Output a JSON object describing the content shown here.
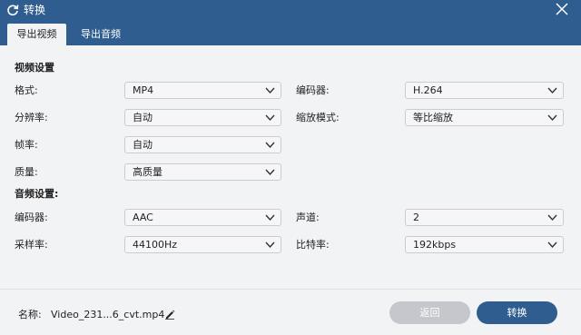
{
  "window": {
    "title": "转换",
    "title_icon": "refresh-icon",
    "close_icon": "close-icon"
  },
  "tabs": [
    {
      "label": "导出视频",
      "active": true
    },
    {
      "label": "导出音频",
      "active": false
    }
  ],
  "video_section": {
    "title": "视频设置",
    "fields": {
      "format": {
        "label": "格式:",
        "value": "MP4"
      },
      "encoder": {
        "label": "编码器:",
        "value": "H.264"
      },
      "resolution": {
        "label": "分辨率:",
        "value": "自动"
      },
      "zoom_mode": {
        "label": "缩放模式:",
        "value": "等比缩放"
      },
      "framerate": {
        "label": "帧率:",
        "value": "自动"
      },
      "quality": {
        "label": "质量:",
        "value": "高质量"
      }
    }
  },
  "audio_section": {
    "title": "音频设置:",
    "fields": {
      "encoder": {
        "label": "编码器:",
        "value": "AAC"
      },
      "channels": {
        "label": "声道:",
        "value": "2"
      },
      "sample_rate": {
        "label": "采样率:",
        "value": "44100Hz"
      },
      "bitrate": {
        "label": "比特率:",
        "value": "192kbps"
      }
    }
  },
  "footer": {
    "name_label": "名称:",
    "file_name": "Video_231...6_cvt.mp4",
    "edit_icon": "pencil-icon",
    "back_label": "返回",
    "convert_label": "转换"
  },
  "colors": {
    "accent": "#2f5d8f",
    "background": "#f2f3f5",
    "disabled_button": "#c5c7cc"
  }
}
